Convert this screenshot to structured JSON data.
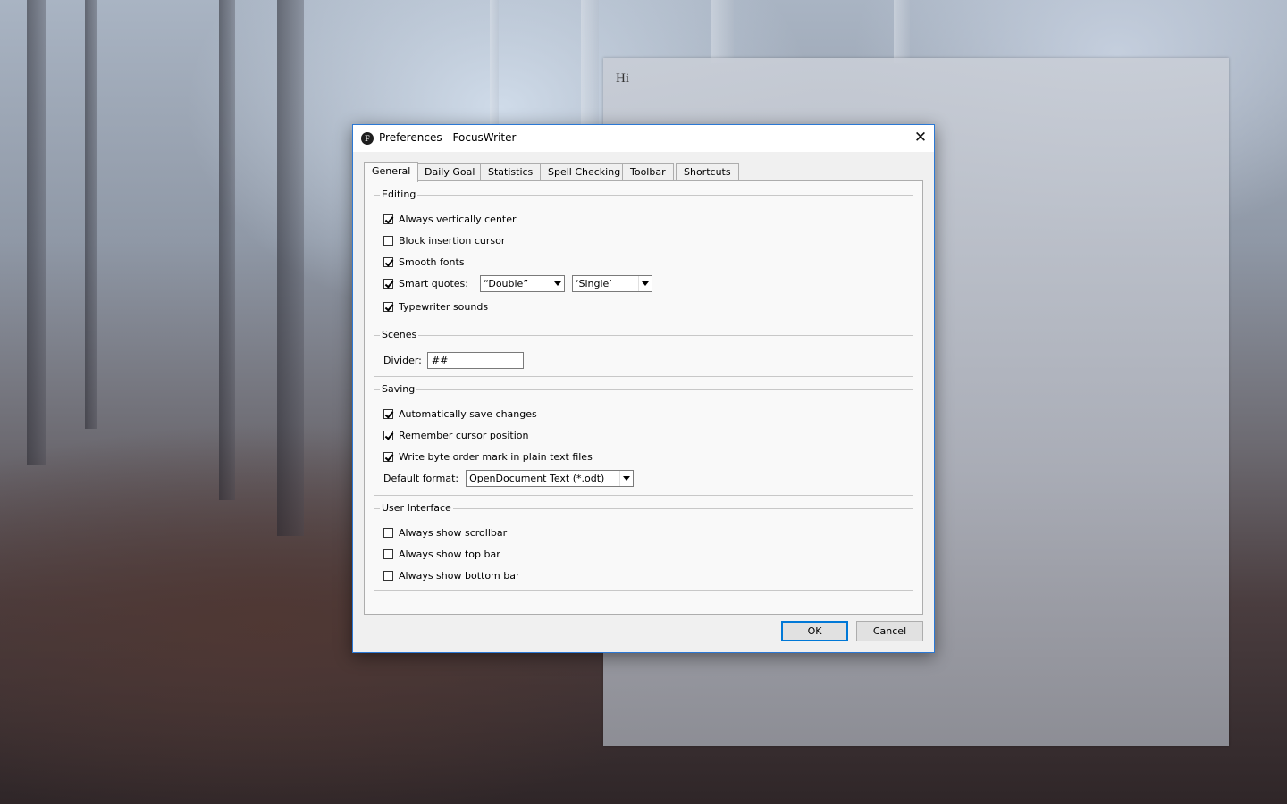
{
  "document": {
    "text": "Hi"
  },
  "dialog": {
    "title": "Preferences - FocusWriter",
    "app_icon": "F",
    "close_glyph": "✕",
    "tabs": [
      {
        "label": "General",
        "active": true
      },
      {
        "label": "Daily Goal",
        "active": false
      },
      {
        "label": "Statistics",
        "active": false
      },
      {
        "label": "Spell Checking",
        "active": false
      },
      {
        "label": "Toolbar",
        "active": false
      },
      {
        "label": "Shortcuts",
        "active": false
      }
    ],
    "editing": {
      "title": "Editing",
      "always_vertically_center": {
        "label": "Always vertically center",
        "checked": true
      },
      "block_insertion_cursor": {
        "label": "Block insertion cursor",
        "checked": false
      },
      "smooth_fonts": {
        "label": "Smooth fonts",
        "checked": true
      },
      "smart_quotes": {
        "label": "Smart quotes:",
        "checked": true,
        "double_value": "“Double”",
        "single_value": "‘Single’"
      },
      "typewriter_sounds": {
        "label": "Typewriter sounds",
        "checked": true
      }
    },
    "scenes": {
      "title": "Scenes",
      "divider_label": "Divider:",
      "divider_value": "##"
    },
    "saving": {
      "title": "Saving",
      "auto_save": {
        "label": "Automatically save changes",
        "checked": true
      },
      "remember_cursor": {
        "label": "Remember cursor position",
        "checked": true
      },
      "byte_order_mark": {
        "label": "Write byte order mark in plain text files",
        "checked": true
      },
      "default_format_label": "Default format:",
      "default_format_value": "OpenDocument Text (*.odt)"
    },
    "user_interface": {
      "title": "User Interface",
      "always_show_scrollbar": {
        "label": "Always show scrollbar",
        "checked": false
      },
      "always_show_top_bar": {
        "label": "Always show top bar",
        "checked": false
      },
      "always_show_bottom_bar": {
        "label": "Always show bottom bar",
        "checked": false
      }
    },
    "buttons": {
      "ok": "OK",
      "cancel": "Cancel"
    }
  },
  "colors": {
    "accent": "#0078d7",
    "dialog_bg": "#f0f0f0",
    "pane_bg": "#f9f9f9"
  }
}
